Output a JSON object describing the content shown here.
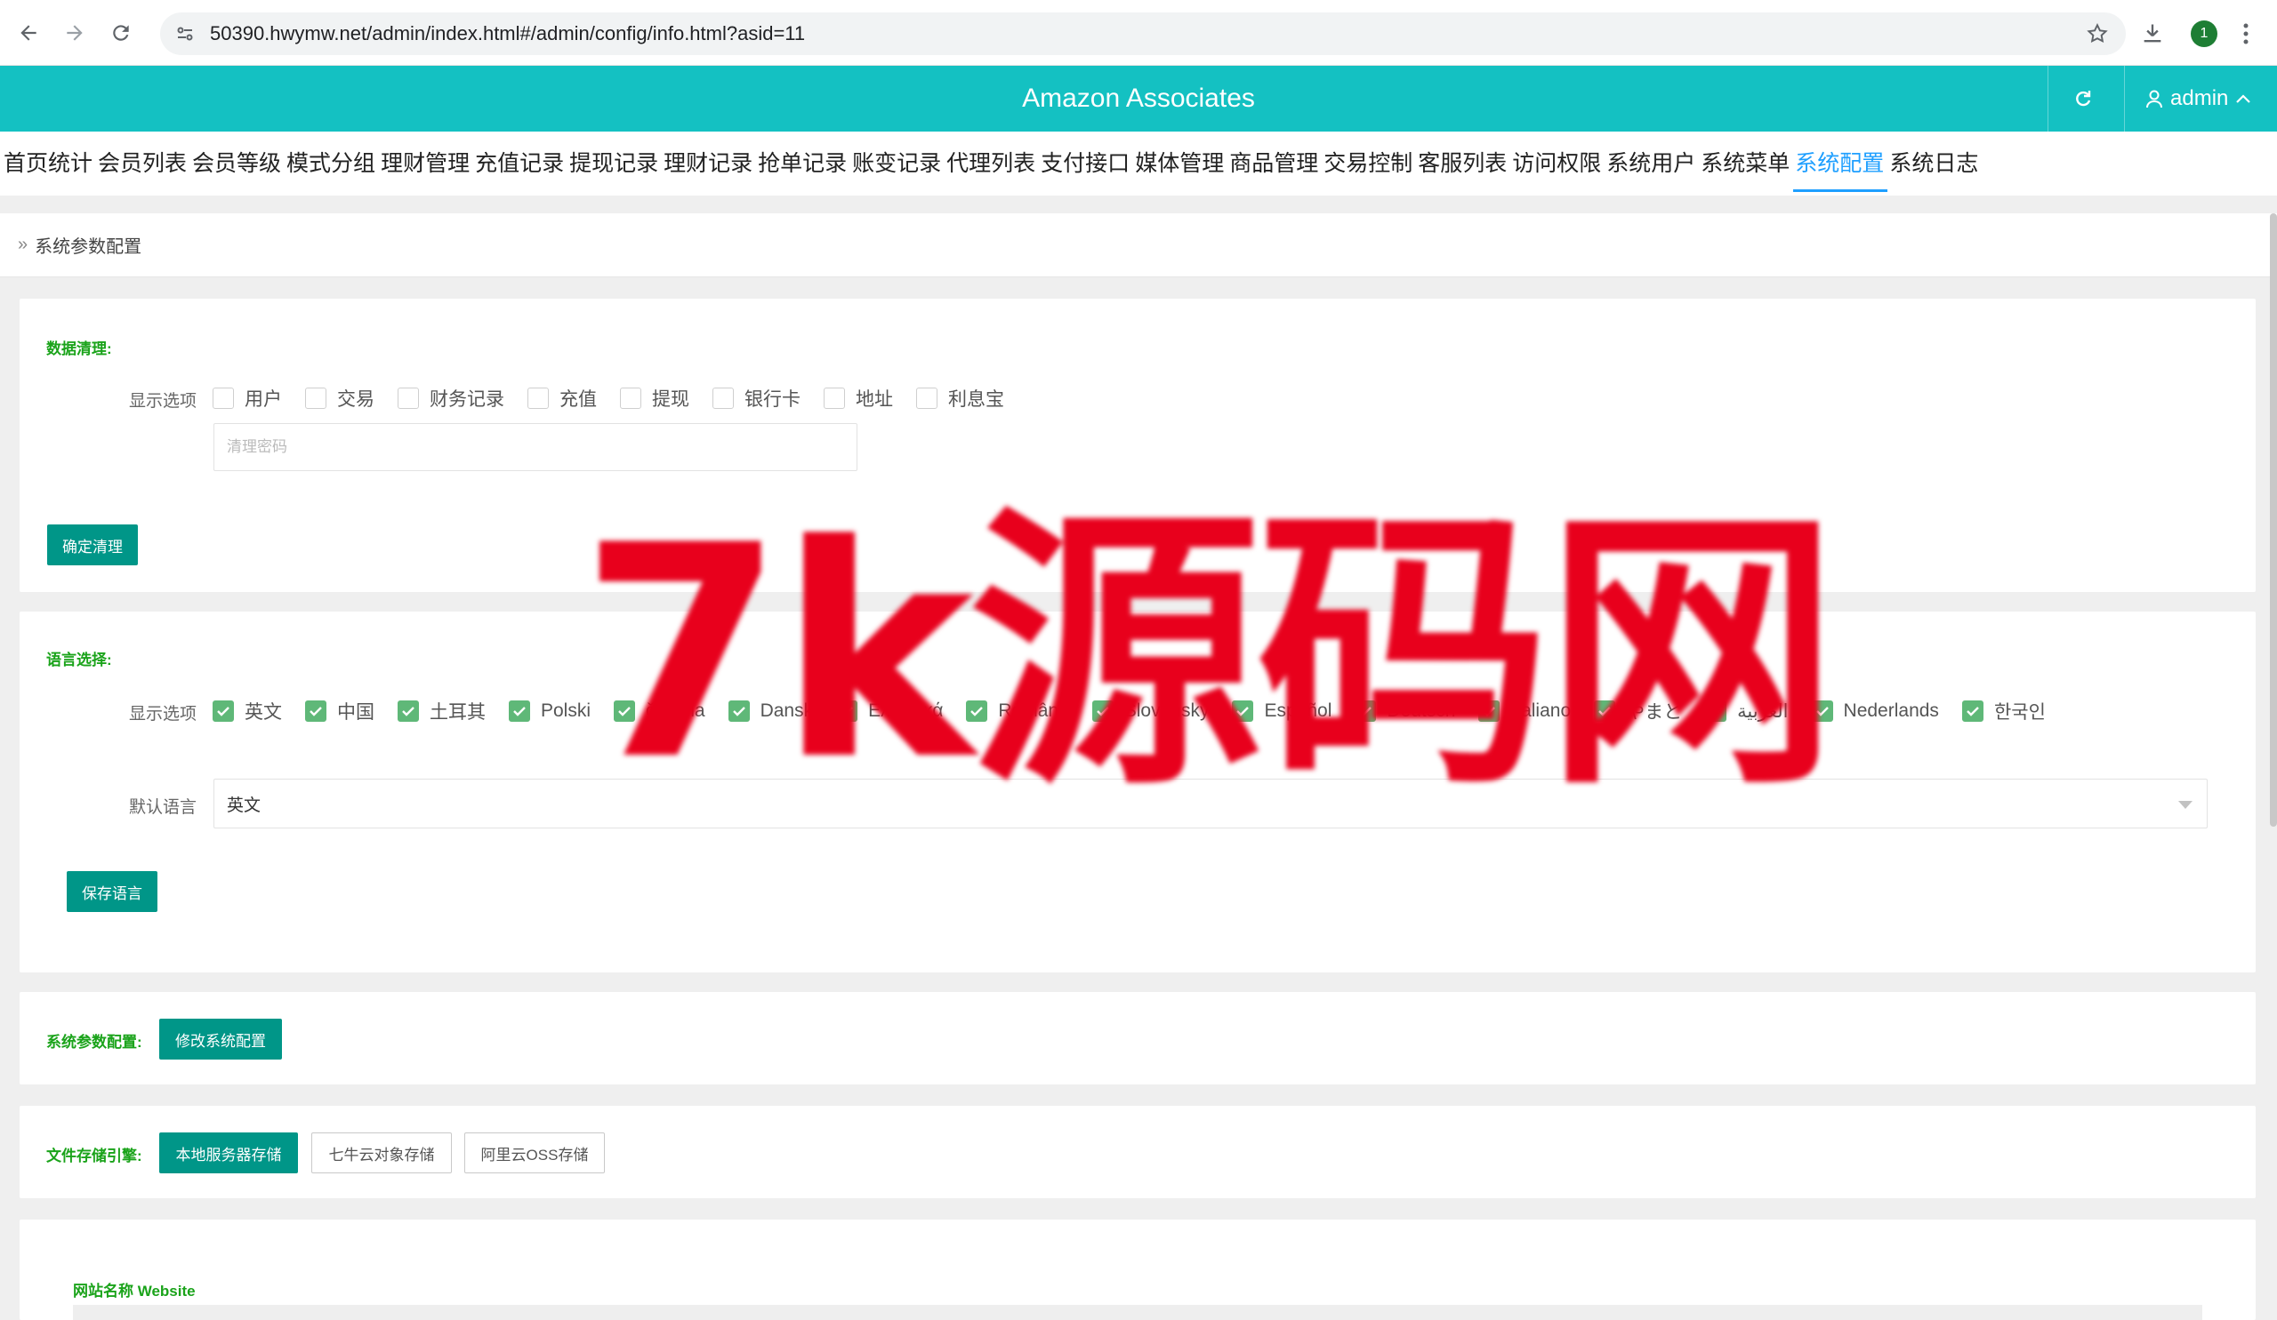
{
  "browser": {
    "url": "50390.hwymw.net/admin/index.html#/admin/config/info.html?asid=11",
    "profile_initial": "1"
  },
  "header": {
    "title": "Amazon Associates",
    "user": "admin"
  },
  "menu": [
    {
      "label": "首页统计"
    },
    {
      "label": "会员列表"
    },
    {
      "label": "会员等级"
    },
    {
      "label": "模式分组"
    },
    {
      "label": "理财管理"
    },
    {
      "label": "充值记录"
    },
    {
      "label": "提现记录"
    },
    {
      "label": "理财记录"
    },
    {
      "label": "抢单记录"
    },
    {
      "label": "账变记录"
    },
    {
      "label": "代理列表"
    },
    {
      "label": "支付接口"
    },
    {
      "label": "媒体管理"
    },
    {
      "label": "商品管理"
    },
    {
      "label": "交易控制"
    },
    {
      "label": "客服列表"
    },
    {
      "label": "访问权限"
    },
    {
      "label": "系统用户"
    },
    {
      "label": "系统菜单"
    },
    {
      "label": "系统配置",
      "active": true
    },
    {
      "label": "系统日志"
    }
  ],
  "breadcrumb": "系统参数配置",
  "data_clean": {
    "title": "数据清理:",
    "options_label": "显示选项",
    "options": [
      {
        "label": "用户",
        "checked": false
      },
      {
        "label": "交易",
        "checked": false
      },
      {
        "label": "财务记录",
        "checked": false
      },
      {
        "label": "充值",
        "checked": false
      },
      {
        "label": "提现",
        "checked": false
      },
      {
        "label": "银行卡",
        "checked": false
      },
      {
        "label": "地址",
        "checked": false
      },
      {
        "label": "利息宝",
        "checked": false
      }
    ],
    "password_placeholder": "清理密码",
    "confirm_button": "确定清理"
  },
  "language": {
    "title": "语言选择:",
    "options_label": "显示选项",
    "options": [
      {
        "label": "英文",
        "checked": true
      },
      {
        "label": "中国",
        "checked": true
      },
      {
        "label": "土耳其",
        "checked": true
      },
      {
        "label": "Polski",
        "checked": true
      },
      {
        "label": "čeština",
        "checked": true
      },
      {
        "label": "Dansk",
        "checked": true
      },
      {
        "label": "Ελληνικά",
        "checked": true
      },
      {
        "label": "Română",
        "checked": true
      },
      {
        "label": "Slovenský",
        "checked": true
      },
      {
        "label": "Español",
        "checked": true
      },
      {
        "label": "Deutsch",
        "checked": true
      },
      {
        "label": "Italiano",
        "checked": true
      },
      {
        "label": "やまと",
        "checked": true
      },
      {
        "label": "العربية",
        "checked": true
      },
      {
        "label": "Nederlands",
        "checked": true
      },
      {
        "label": "한국인",
        "checked": true
      }
    ],
    "default_label": "默认语言",
    "default_value": "英文",
    "save_button": "保存语言"
  },
  "system_params": {
    "title": "系统参数配置:",
    "edit_button": "修改系统配置"
  },
  "storage": {
    "title": "文件存储引擎:",
    "engines": [
      {
        "label": "本地服务器存储",
        "active": true
      },
      {
        "label": "七牛云对象存储",
        "active": false
      },
      {
        "label": "阿里云OSS存储",
        "active": false
      }
    ]
  },
  "website": {
    "label": "网站名称 Website"
  },
  "watermark": "7k源码网"
}
